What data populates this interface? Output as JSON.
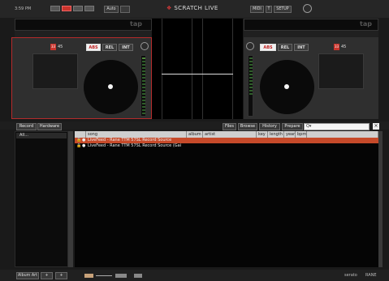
{
  "app": {
    "time": "3:59 PM",
    "logo_main": "SCRATCH",
    "logo_suffix": "LIVE"
  },
  "topbar": {
    "auto_label": "Auto",
    "midi_label": "MIDI",
    "t_label": "T",
    "setup_label": "SETUP"
  },
  "decks": {
    "left": {
      "tap": "tap",
      "bpm": "45",
      "abs": "ABS",
      "rel": "REL",
      "int": "INT"
    },
    "right": {
      "tap": "tap",
      "bpm": "45",
      "abs": "ABS",
      "rel": "REL",
      "int": "INT"
    }
  },
  "browser": {
    "tabs_left": [
      "Record",
      "Hardware"
    ],
    "tabs_right": [
      "Files",
      "Browse",
      "History",
      "Prepare"
    ],
    "search_placeholder": "Q▾",
    "sidebar_items": [
      "All..."
    ],
    "columns": [
      "song",
      "album",
      "artist",
      "key",
      "length",
      "year",
      "bpm"
    ],
    "rows": [
      {
        "song": "LiveFeed - Rane TTM 57SL Record Source",
        "selected": true
      },
      {
        "song": "LiveFeed - Rane TTM 57SL Record Source (Gai",
        "selected": false
      }
    ]
  },
  "bottom": {
    "album_art": "Album Art",
    "brand1": "serato",
    "brand2": "RANE"
  },
  "colors": {
    "accent_red": "#c9342c",
    "selected_row": "#c64a2a"
  }
}
